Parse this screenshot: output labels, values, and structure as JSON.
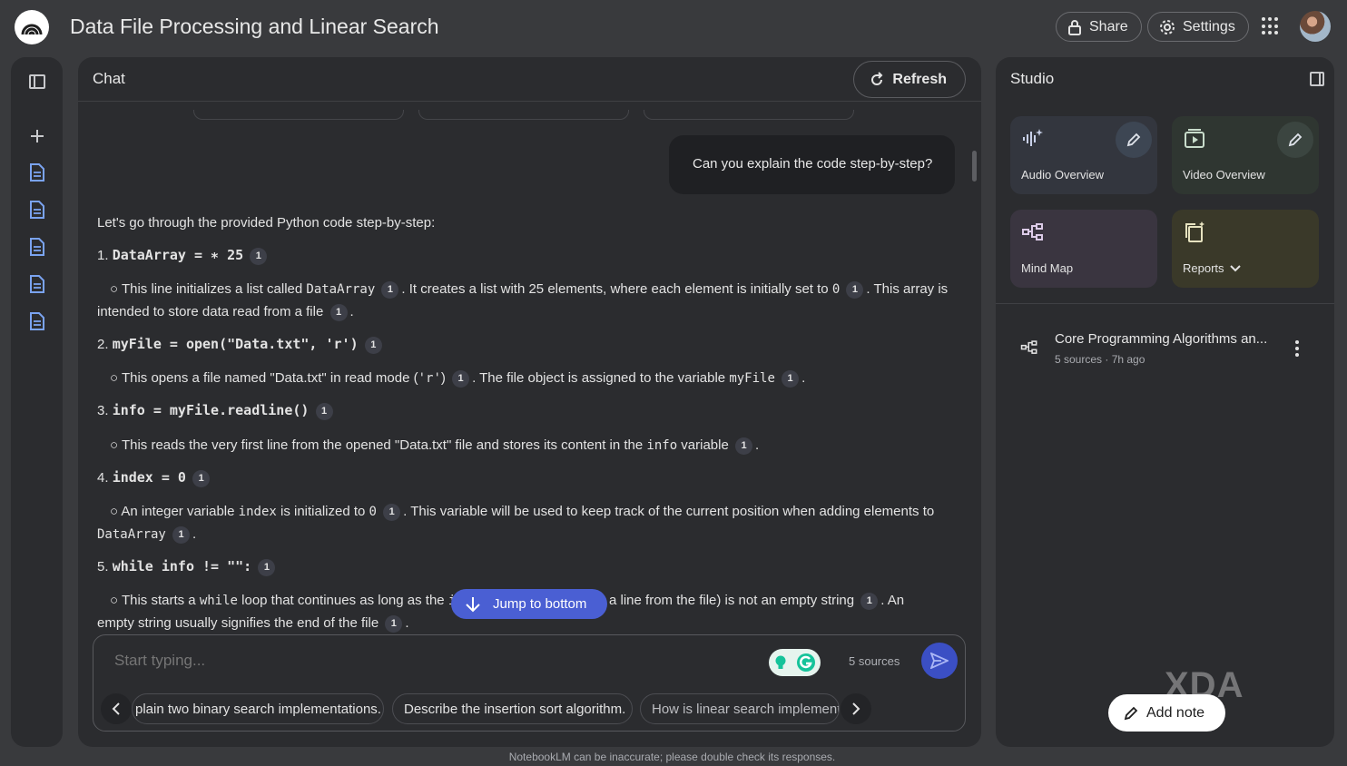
{
  "app": {
    "title": "Data File Processing and Linear Search",
    "share_label": "Share",
    "settings_label": "Settings"
  },
  "chat": {
    "title": "Chat",
    "refresh_label": "Refresh",
    "user_message": "Can you explain the code step-by-step?",
    "intro": "Let's go through the provided Python code step-by-step:",
    "cite": "1",
    "steps": {
      "s1_num": "1.",
      "s1_code": "DataArray = ∗ 25",
      "s1_b1": "○ This line initializes a list called",
      "s1_b1_code": "DataArray",
      "s1_b2": ". It creates a list with 25 elements, where each element is initially set to",
      "s1_b2_code": "0",
      "s1_b3": ". This array is",
      "s1_b4": "intended to store data read from a file",
      "s1_b4_end": ".",
      "s2_num": "2.",
      "s2_code": "myFile = open(\"Data.txt\", 'r')",
      "s2_b1": "○ This opens a file named \"Data.txt\" in read mode (",
      "s2_b1_code": "'r'",
      "s2_b2": ")",
      "s2_b3": ". The file object is assigned to the variable",
      "s2_b3_code": "myFile",
      "s2_b4": ".",
      "s3_num": "3.",
      "s3_code": "info = myFile.readline()",
      "s3_b1": "○ This reads the very first line from the opened \"Data.txt\" file and stores its content in the",
      "s3_b1_code": "info",
      "s3_b2": "variable",
      "s3_b3": ".",
      "s4_num": "4.",
      "s4_code": "index = 0",
      "s4_b1": "○ An integer variable",
      "s4_b1_code": "index",
      "s4_b2": "is initialized to",
      "s4_b2_code": "0",
      "s4_b3": ". This variable will be used to keep track of the current position when adding elements to",
      "s4_b4_code": "DataArray",
      "s4_b4": ".",
      "s5_num": "5.",
      "s5_code": "while info != \"\":",
      "s5_b1": "○ This starts a",
      "s5_b1_code": "while",
      "s5_b2": "loop that continues as long as the",
      "s5_b2_code": "i",
      "s5_b3": "a line from the file) is not an empty string",
      "s5_b4": ". An",
      "s5_b5": "empty string usually signifies the end of the file",
      "s5_b6": "."
    },
    "jump_label": "Jump to bottom",
    "input_placeholder": "Start typing...",
    "sources_count": "5 sources",
    "suggestions": [
      "plain two binary search implementations.",
      "Describe the insertion sort algorithm.",
      "How is linear search implemente"
    ],
    "disclaimer": "NotebookLM can be inaccurate; please double check its responses."
  },
  "studio": {
    "title": "Studio",
    "cards": [
      {
        "label": "Audio Overview",
        "color": "#33363e"
      },
      {
        "label": "Video Overview",
        "color": "#2f3631"
      },
      {
        "label": "Mind Map",
        "color": "#3a3540"
      },
      {
        "label": "Reports",
        "color": "#3a3929"
      }
    ],
    "note": {
      "title": "Core Programming Algorithms an...",
      "meta": "5 sources · 7h ago"
    },
    "add_note_label": "Add note",
    "watermark": "XDA"
  }
}
